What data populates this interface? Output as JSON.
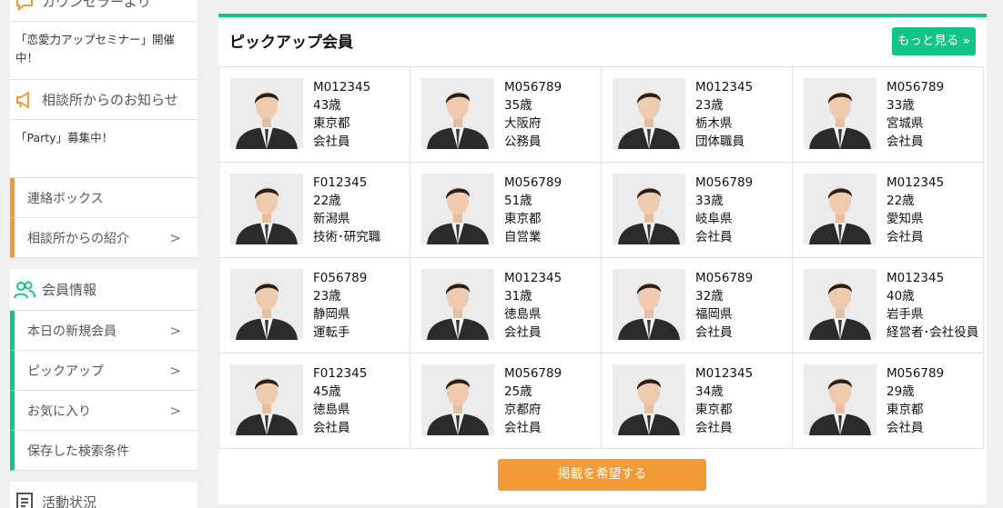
{
  "sidebar": {
    "counselor_header": "カウンセラーより",
    "counselor_note": "「恋愛力アップセミナー」開催中！",
    "notice_header": "相談所からのお知らせ",
    "notice_note": "「Party」募集中！",
    "contact_items": [
      {
        "label": "連絡ボックス",
        "chevron": ""
      },
      {
        "label": "相談所からの紹介",
        "chevron": ">"
      }
    ],
    "member_header": "会員情報",
    "member_items": [
      {
        "label": "本日の新規会員",
        "chevron": ">"
      },
      {
        "label": "ピックアップ",
        "chevron": ">"
      },
      {
        "label": "お気に入り",
        "chevron": ">"
      },
      {
        "label": "保存した検索条件",
        "chevron": ""
      }
    ],
    "activity_header": "活動状況"
  },
  "main": {
    "title": "ピックアップ会員",
    "more_label": "もっと見る »",
    "cta_label": "掲載を希望する",
    "members": [
      {
        "id": "M012345",
        "age": "43歳",
        "pref": "東京都",
        "job": "会社員"
      },
      {
        "id": "M056789",
        "age": "35歳",
        "pref": "大阪府",
        "job": "公務員"
      },
      {
        "id": "M012345",
        "age": "23歳",
        "pref": "栃木県",
        "job": "団体職員"
      },
      {
        "id": "M056789",
        "age": "33歳",
        "pref": "宮城県",
        "job": "会社員"
      },
      {
        "id": "F012345",
        "age": "22歳",
        "pref": "新潟県",
        "job": "技術･研究職"
      },
      {
        "id": "M056789",
        "age": "51歳",
        "pref": "東京都",
        "job": "自営業"
      },
      {
        "id": "M056789",
        "age": "33歳",
        "pref": "岐阜県",
        "job": "会社員"
      },
      {
        "id": "M012345",
        "age": "22歳",
        "pref": "愛知県",
        "job": "会社員"
      },
      {
        "id": "F056789",
        "age": "23歳",
        "pref": "静岡県",
        "job": "運転手"
      },
      {
        "id": "M012345",
        "age": "31歳",
        "pref": "徳島県",
        "job": "会社員"
      },
      {
        "id": "M056789",
        "age": "32歳",
        "pref": "福岡県",
        "job": "会社員"
      },
      {
        "id": "M012345",
        "age": "40歳",
        "pref": "岩手県",
        "job": "経営者･会社役員"
      },
      {
        "id": "F012345",
        "age": "45歳",
        "pref": "徳島県",
        "job": "会社員"
      },
      {
        "id": "M056789",
        "age": "25歳",
        "pref": "京都府",
        "job": "会社員"
      },
      {
        "id": "M012345",
        "age": "34歳",
        "pref": "東京都",
        "job": "会社員"
      },
      {
        "id": "M056789",
        "age": "29歳",
        "pref": "東京都",
        "job": "会社員"
      }
    ]
  },
  "colors": {
    "accent_green": "#13c487",
    "accent_orange": "#f29a38"
  },
  "icons": {
    "counselor": "speech-bubble-icon",
    "notice": "megaphone-icon",
    "member": "people-icon",
    "activity": "clipboard-icon",
    "chevron": "chevron-right-icon",
    "photo": "member-photo"
  }
}
